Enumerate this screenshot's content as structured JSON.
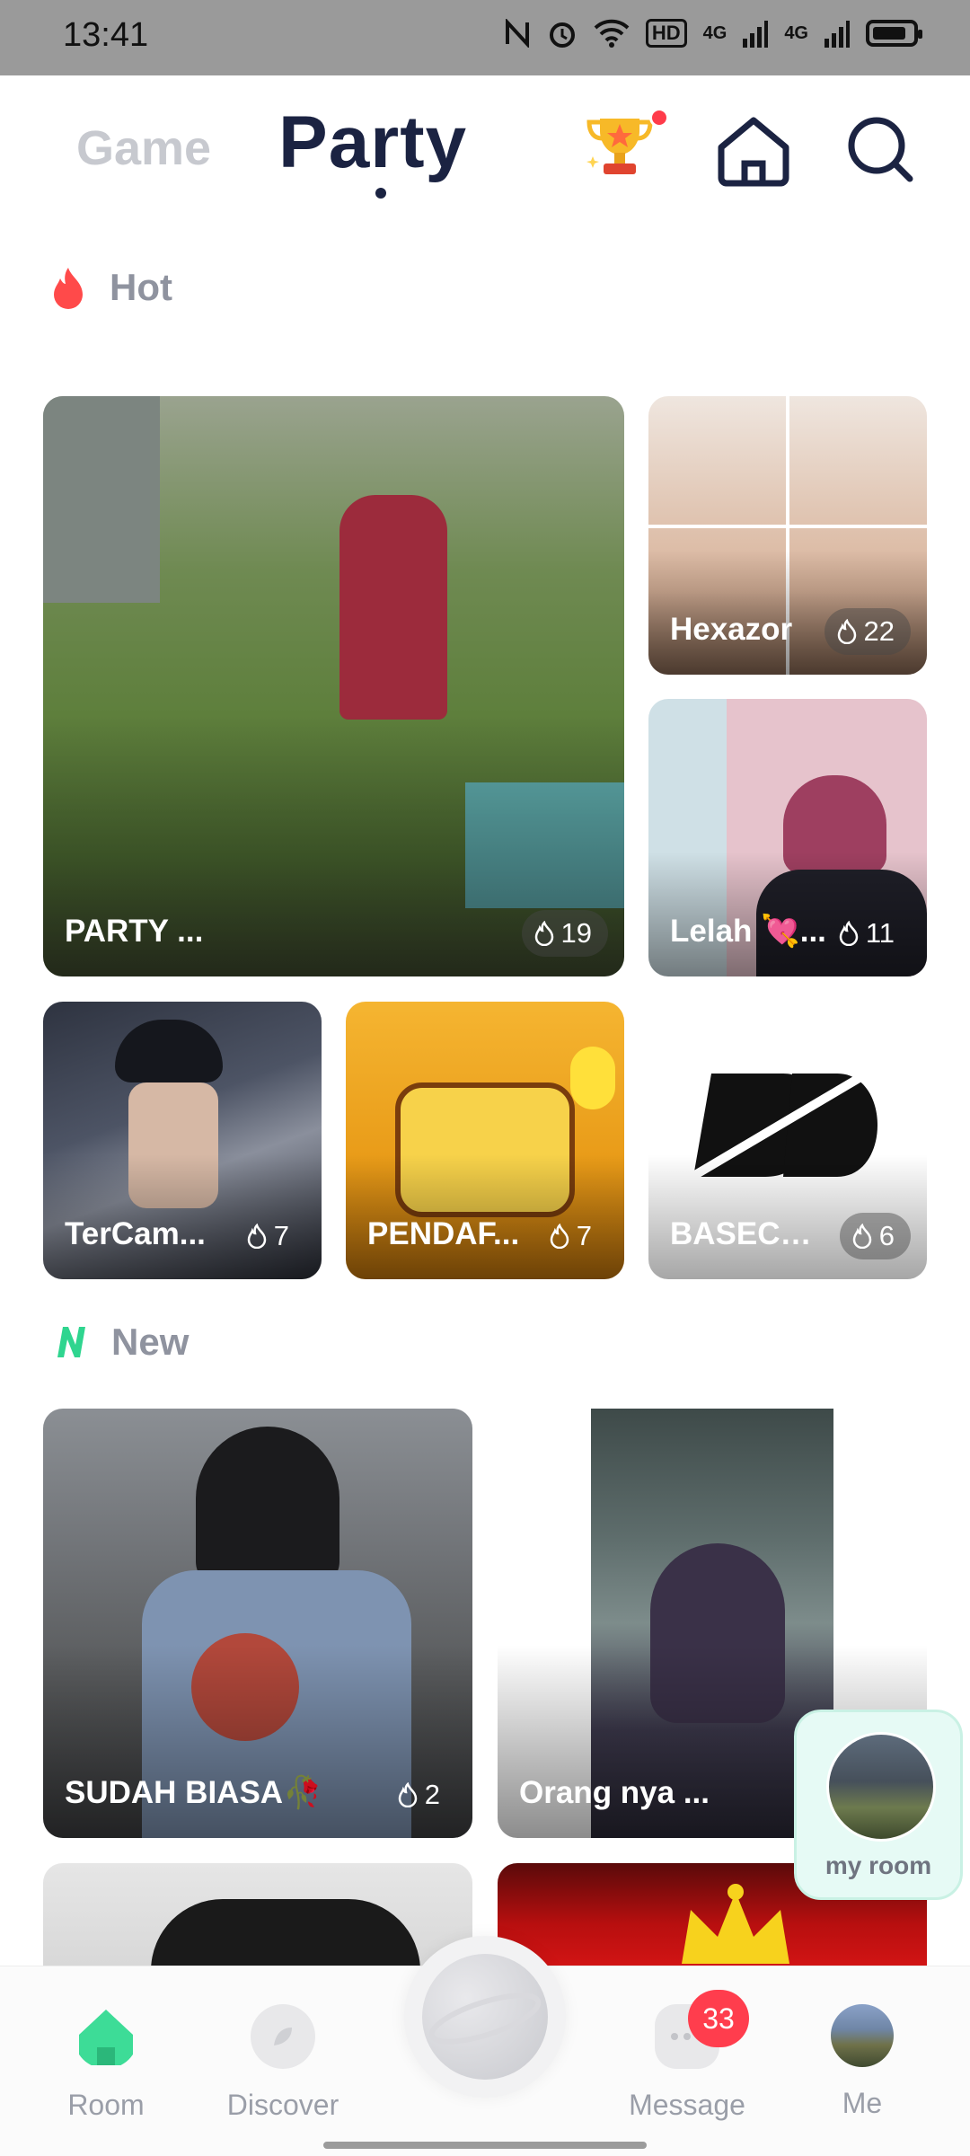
{
  "status_bar": {
    "time": "13:41",
    "network": "4G",
    "network2": "4G",
    "hd": "HD"
  },
  "header": {
    "tab_game": "Game",
    "tab_party": "Party",
    "icons": [
      "trophy-icon",
      "home-icon",
      "search-icon"
    ]
  },
  "sections": {
    "hot": "Hot",
    "new": "New"
  },
  "hot_rooms": [
    {
      "title": "PARTY ...",
      "heat": "19"
    },
    {
      "title": "Hexazor",
      "heat": "22"
    },
    {
      "title": "Lelah 💘...",
      "heat": "11"
    },
    {
      "title": "TerCam...",
      "heat": "7"
    },
    {
      "title": "PENDAF...",
      "heat": "7"
    },
    {
      "title": "BASECA...",
      "heat": "6"
    }
  ],
  "new_rooms": [
    {
      "title": "SUDAH BIASA🥀",
      "heat": "2"
    },
    {
      "title": "Orang nya ...",
      "heat": ""
    }
  ],
  "my_room": {
    "label": "my room"
  },
  "bottom_nav": {
    "room": "Room",
    "discover": "Discover",
    "message": "Message",
    "message_badge": "33",
    "me": "Me"
  },
  "colors": {
    "accent_green": "#3ddc97",
    "badge_red": "#ff3d4d",
    "title_navy": "#1b2342",
    "hot_red": "#ff4a4a"
  }
}
